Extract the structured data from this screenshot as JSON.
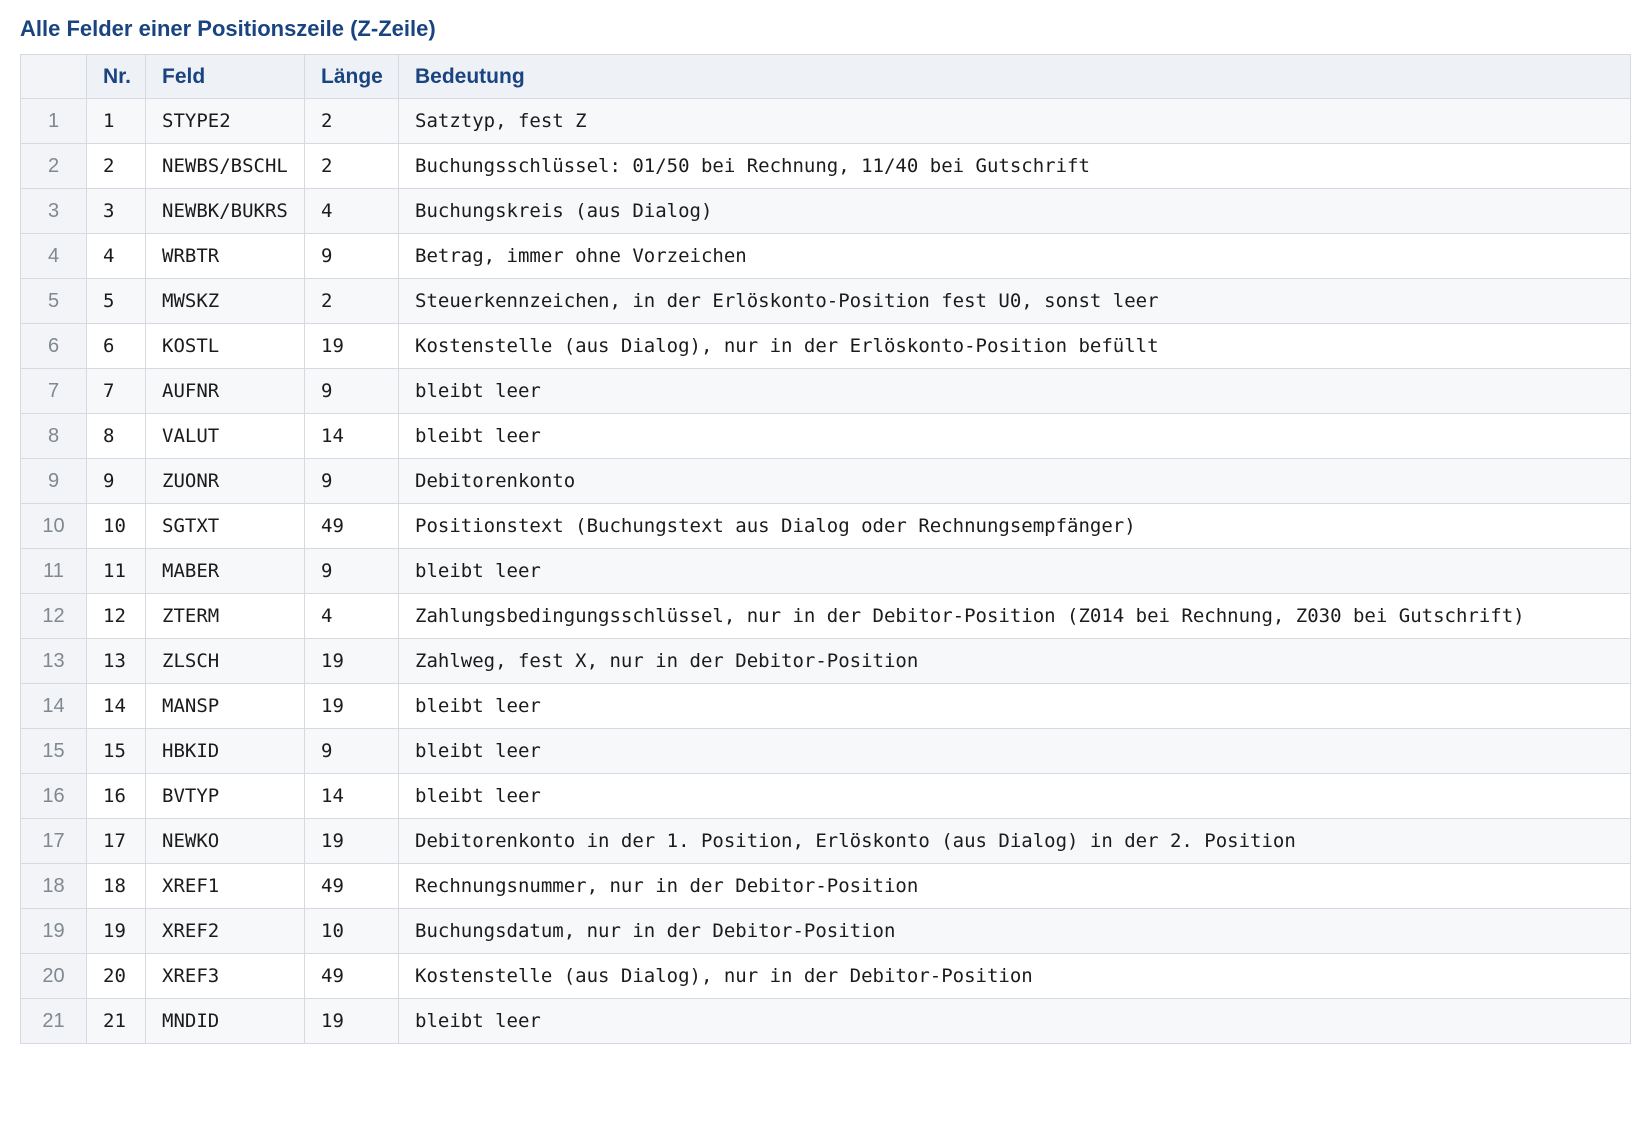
{
  "title": "Alle Felder einer Positionszeile (Z-Zeile)",
  "columns": [
    "",
    "Nr.",
    "Feld",
    "Länge",
    "Bedeutung"
  ],
  "rows": [
    {
      "index": "1",
      "nr": "1",
      "feld": "STYPE2",
      "laenge": "2",
      "bedeutung": "Satztyp, fest Z"
    },
    {
      "index": "2",
      "nr": "2",
      "feld": "NEWBS/BSCHL",
      "laenge": "2",
      "bedeutung": "Buchungsschlüssel: 01/50 bei Rechnung, 11/40 bei Gutschrift"
    },
    {
      "index": "3",
      "nr": "3",
      "feld": "NEWBK/BUKRS",
      "laenge": "4",
      "bedeutung": "Buchungskreis (aus Dialog)"
    },
    {
      "index": "4",
      "nr": "4",
      "feld": "WRBTR",
      "laenge": "9",
      "bedeutung": "Betrag, immer ohne Vorzeichen"
    },
    {
      "index": "5",
      "nr": "5",
      "feld": "MWSKZ",
      "laenge": "2",
      "bedeutung": "Steuerkennzeichen, in der Erlöskonto-Position fest U0, sonst leer"
    },
    {
      "index": "6",
      "nr": "6",
      "feld": "KOSTL",
      "laenge": "19",
      "bedeutung": "Kostenstelle (aus Dialog), nur in der Erlöskonto-Position befüllt"
    },
    {
      "index": "7",
      "nr": "7",
      "feld": "AUFNR",
      "laenge": "9",
      "bedeutung": "bleibt leer"
    },
    {
      "index": "8",
      "nr": "8",
      "feld": "VALUT",
      "laenge": "14",
      "bedeutung": "bleibt leer"
    },
    {
      "index": "9",
      "nr": "9",
      "feld": "ZUONR",
      "laenge": "9",
      "bedeutung": "Debitorenkonto"
    },
    {
      "index": "10",
      "nr": "10",
      "feld": "SGTXT",
      "laenge": "49",
      "bedeutung": "Positionstext (Buchungstext aus Dialog oder Rechnungsempfänger)"
    },
    {
      "index": "11",
      "nr": "11",
      "feld": "MABER",
      "laenge": "9",
      "bedeutung": "bleibt leer"
    },
    {
      "index": "12",
      "nr": "12",
      "feld": "ZTERM",
      "laenge": "4",
      "bedeutung": "Zahlungsbedingungsschlüssel, nur in der Debitor-Position (Z014 bei Rechnung, Z030 bei Gutschrift)"
    },
    {
      "index": "13",
      "nr": "13",
      "feld": "ZLSCH",
      "laenge": "19",
      "bedeutung": "Zahlweg, fest X, nur in der Debitor-Position"
    },
    {
      "index": "14",
      "nr": "14",
      "feld": "MANSP",
      "laenge": "19",
      "bedeutung": "bleibt leer"
    },
    {
      "index": "15",
      "nr": "15",
      "feld": "HBKID",
      "laenge": "9",
      "bedeutung": "bleibt leer"
    },
    {
      "index": "16",
      "nr": "16",
      "feld": "BVTYP",
      "laenge": "14",
      "bedeutung": "bleibt leer"
    },
    {
      "index": "17",
      "nr": "17",
      "feld": "NEWKO",
      "laenge": "19",
      "bedeutung": "Debitorenkonto in der 1. Position, Erlöskonto (aus Dialog) in der 2. Position"
    },
    {
      "index": "18",
      "nr": "18",
      "feld": "XREF1",
      "laenge": "49",
      "bedeutung": "Rechnungsnummer, nur in der Debitor-Position"
    },
    {
      "index": "19",
      "nr": "19",
      "feld": "XREF2",
      "laenge": "10",
      "bedeutung": "Buchungsdatum, nur in der Debitor-Position"
    },
    {
      "index": "20",
      "nr": "20",
      "feld": "XREF3",
      "laenge": "49",
      "bedeutung": "Kostenstelle (aus Dialog), nur in der Debitor-Position"
    },
    {
      "index": "21",
      "nr": "21",
      "feld": "MNDID",
      "laenge": "19",
      "bedeutung": "bleibt leer"
    }
  ]
}
